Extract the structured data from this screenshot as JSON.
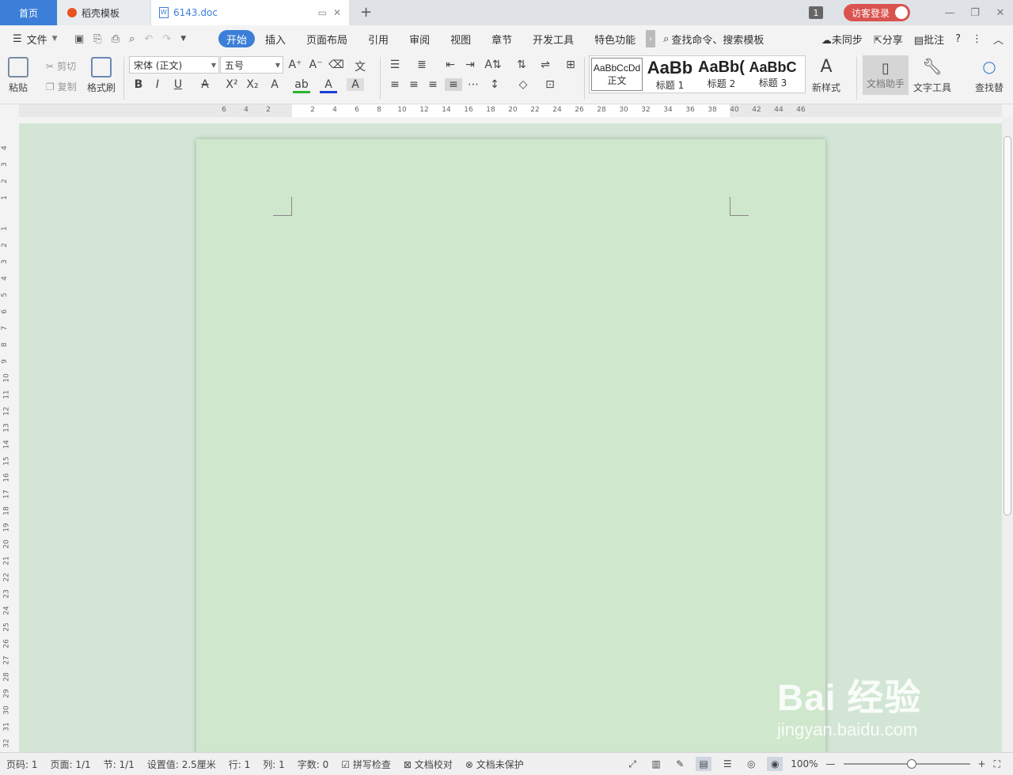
{
  "tabs": {
    "home": "首页",
    "docer": "稻壳模板",
    "doc": "6143.doc"
  },
  "titlebar": {
    "badge": "1",
    "login": "访客登录"
  },
  "menu": {
    "file": "文件",
    "items": [
      "开始",
      "插入",
      "页面布局",
      "引用",
      "审阅",
      "视图",
      "章节",
      "开发工具",
      "特色功能"
    ],
    "search": "查找命令、搜索模板",
    "sync": "未同步",
    "share": "分享",
    "comment": "批注"
  },
  "ribbon": {
    "paste": "粘贴",
    "cut": "剪切",
    "copy": "复制",
    "format_painter": "格式刷",
    "font_name": "宋体 (正文)",
    "font_size": "五号",
    "styles": [
      {
        "preview": "AaBbCcDd",
        "label": "正文"
      },
      {
        "preview": "AaBb",
        "label": "标题 1"
      },
      {
        "preview": "AaBb(",
        "label": "标题 2"
      },
      {
        "preview": "AaBbC",
        "label": "标题 3"
      }
    ],
    "new_style": "新样式",
    "doc_assistant": "文档助手",
    "text_tools": "文字工具",
    "find": "查找替"
  },
  "ruler": {
    "h_ticks": [
      "6",
      "4",
      "2",
      "2",
      "4",
      "6",
      "8",
      "10",
      "12",
      "14",
      "16",
      "18",
      "20",
      "22",
      "24",
      "26",
      "28",
      "30",
      "32",
      "34",
      "36",
      "38",
      "40",
      "42",
      "44",
      "46"
    ],
    "v_ticks": [
      "4",
      "3",
      "2",
      "1",
      "1",
      "2",
      "3",
      "4",
      "5",
      "6",
      "7",
      "8",
      "9",
      "10",
      "11",
      "12",
      "13",
      "14",
      "15",
      "16",
      "17",
      "18",
      "19",
      "20",
      "21",
      "22",
      "23",
      "24",
      "25",
      "26",
      "27",
      "28",
      "29",
      "30",
      "31",
      "32"
    ]
  },
  "status": {
    "page_num": "页码: 1",
    "pages": "页面: 1/1",
    "section": "节: 1/1",
    "setting": "设置值: 2.5厘米",
    "row": "行: 1",
    "col": "列: 1",
    "words": "字数: 0",
    "spell": "拼写检查",
    "proof": "文档校对",
    "protect": "文档未保护",
    "zoom": "100%"
  },
  "watermark": {
    "brand": "Bai 经验",
    "url": "jingyan.baidu.com"
  }
}
